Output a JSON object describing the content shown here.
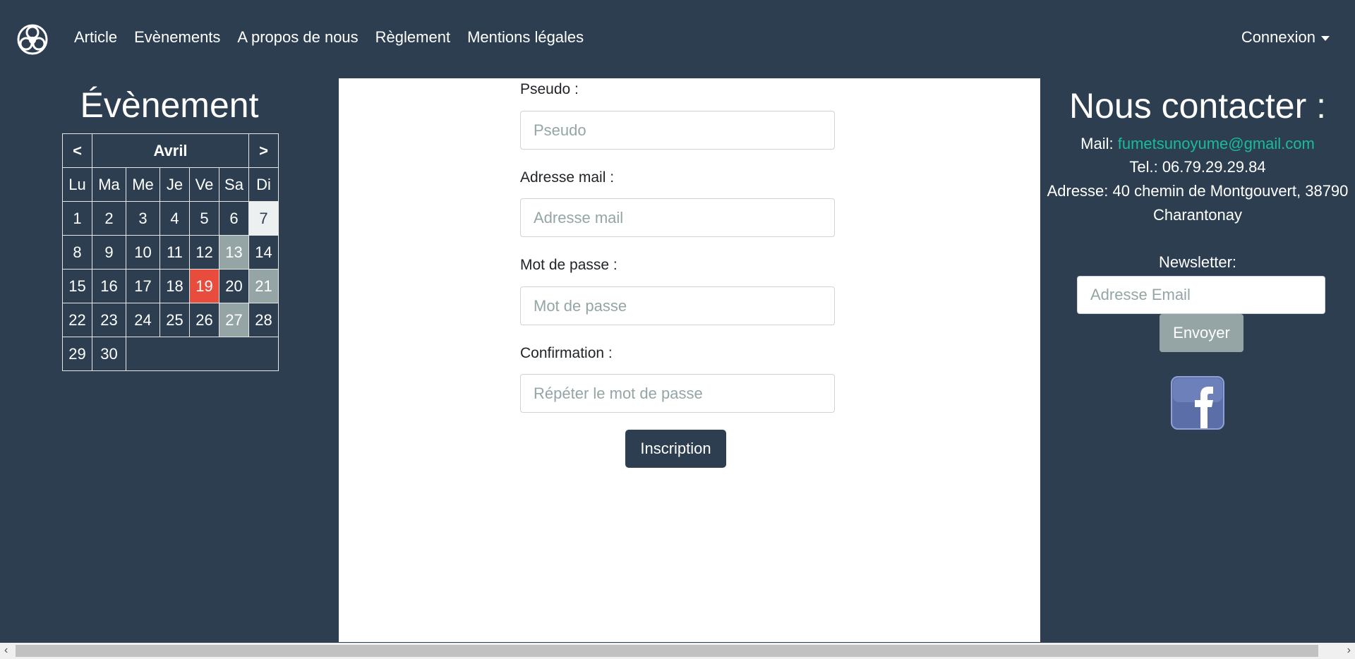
{
  "nav": {
    "links": [
      "Article",
      "Evènements",
      "A propos de nous",
      "Règlement",
      "Mentions légales"
    ],
    "connexion": "Connexion"
  },
  "left": {
    "title": "Évènement",
    "calendar": {
      "prev": "<",
      "next": ">",
      "month": "Avril",
      "weekdays": [
        "Lu",
        "Ma",
        "Me",
        "Je",
        "Ve",
        "Sa",
        "Di"
      ],
      "weeks": [
        [
          "1",
          "2",
          "3",
          "4",
          "5",
          "6",
          "7"
        ],
        [
          "8",
          "9",
          "10",
          "11",
          "12",
          "13",
          "14"
        ],
        [
          "15",
          "16",
          "17",
          "18",
          "19",
          "20",
          "21"
        ],
        [
          "22",
          "23",
          "24",
          "25",
          "26",
          "27",
          "28"
        ],
        [
          "29",
          "30"
        ]
      ],
      "today_day": "7",
      "event_days": [
        "13",
        "21",
        "27"
      ],
      "highlight_day": "19"
    }
  },
  "form": {
    "pseudo_label": "Pseudo :",
    "pseudo_placeholder": "Pseudo",
    "email_label": "Adresse mail :",
    "email_placeholder": "Adresse mail",
    "password_label": "Mot de passe :",
    "password_placeholder": "Mot de passe",
    "confirm_label": "Confirmation :",
    "confirm_placeholder": "Répéter le mot de passe",
    "submit_label": "Inscription"
  },
  "contact": {
    "title": "Nous contacter :",
    "mail_prefix": "Mail:",
    "mail": "fumetsunoyume@gmail.com",
    "tel": "Tel.: 06.79.29.29.84",
    "address_line1": "Adresse: 40 chemin de Montgouvert, 38790",
    "address_line2": "Charantonay",
    "newsletter_label": "Newsletter:",
    "newsletter_placeholder": "Adresse Email",
    "send_label": "Envoyer"
  },
  "colors": {
    "primary": "#2c3e50",
    "accent": "#18bc9c",
    "danger": "#e74c3c",
    "muted": "#95a5a6"
  },
  "icons": {
    "logo": "triskelion-logo-icon",
    "social": "facebook-icon"
  }
}
